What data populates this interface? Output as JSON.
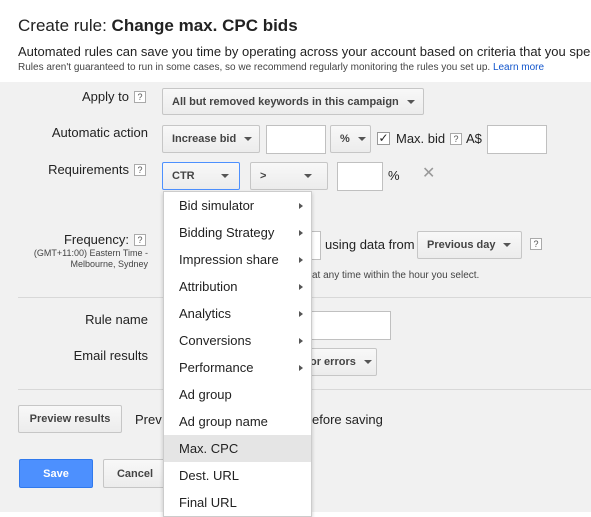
{
  "header": {
    "title_prefix": "Create rule: ",
    "title_name": "Change max. CPC bids",
    "description": "Automated rules can save you time by operating across your account based on criteria that you spec",
    "note": "Rules aren't guaranteed to run in some cases, so we recommend regularly monitoring the rules you set up.",
    "learn_more": "Learn more"
  },
  "apply_to": {
    "label": "Apply to",
    "help": "?",
    "value": "All but removed keywords in this campaign"
  },
  "automatic_action": {
    "label": "Automatic action",
    "action_value": "Increase bid",
    "amount_value": "",
    "unit_value": "%",
    "max_bid_checked": true,
    "max_bid_label": "Max. bid",
    "help": "?",
    "currency": "A$",
    "max_bid_value": ""
  },
  "requirements": {
    "label": "Requirements",
    "help": "?",
    "metric_value": "CTR",
    "operator_value": ">",
    "threshold_value": "",
    "unit": "%",
    "remove_icon": "✕"
  },
  "frequency": {
    "label": "Frequency:",
    "help": "?",
    "timezone_line1": "(GMT+11:00) Eastern Time -",
    "timezone_line2": "Melbourne, Sydney",
    "using_data_label": "using data from",
    "data_range_value": "Previous day",
    "range_help": "?",
    "note_fragment": "at any time within the hour you select."
  },
  "rule_name": {
    "label": "Rule name",
    "value": ""
  },
  "email_results": {
    "label": "Email results",
    "value_fragment": "or errors"
  },
  "preview": {
    "button": "Preview results",
    "text_fragment_left": "Prev",
    "text_fragment_right": "efore saving"
  },
  "footer": {
    "save": "Save",
    "cancel": "Cancel"
  },
  "metric_menu": {
    "items": [
      {
        "label": "Bid simulator",
        "submenu": true
      },
      {
        "label": "Bidding Strategy",
        "submenu": true
      },
      {
        "label": "Impression share",
        "submenu": true
      },
      {
        "label": "Attribution",
        "submenu": true
      },
      {
        "label": "Analytics",
        "submenu": true
      },
      {
        "label": "Conversions",
        "submenu": true
      },
      {
        "label": "Performance",
        "submenu": true
      },
      {
        "label": "Ad group",
        "submenu": false
      },
      {
        "label": "Ad group name",
        "submenu": false
      },
      {
        "label": "Max. CPC",
        "submenu": false,
        "highlighted": true
      },
      {
        "label": "Dest. URL",
        "submenu": false
      },
      {
        "label": "Final URL",
        "submenu": false
      }
    ]
  },
  "colors": {
    "primary_button": "#4d90fe",
    "link": "#1155cc",
    "panel_bg": "#f1f1f1"
  }
}
